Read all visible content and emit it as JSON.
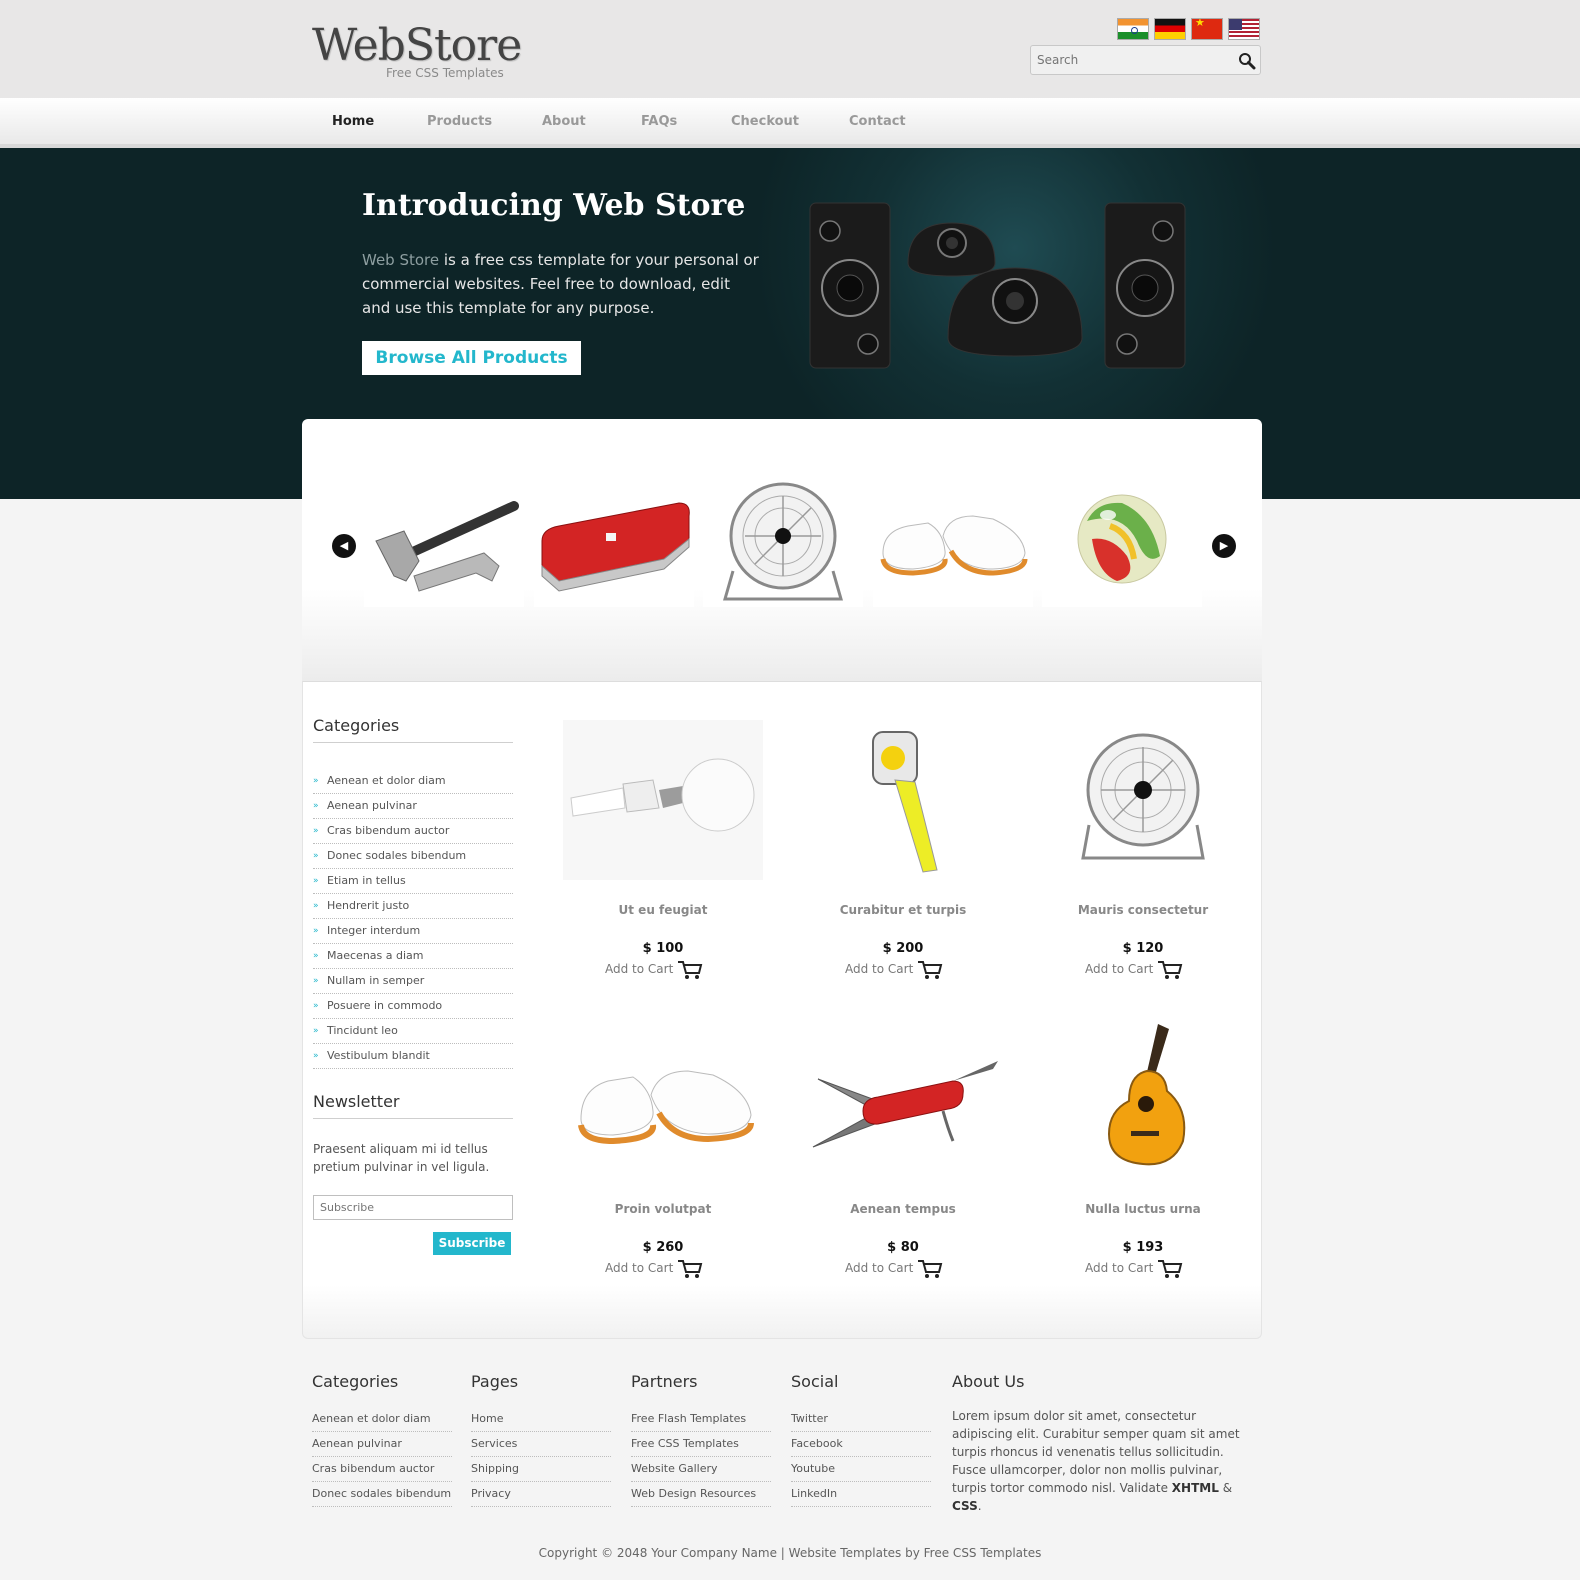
{
  "header": {
    "logo_title": "WebStore",
    "logo_subtitle": "Free CSS Templates",
    "languages": [
      "India",
      "Germany",
      "China",
      "United States"
    ],
    "search_placeholder": "Search"
  },
  "nav": {
    "items": [
      "Home",
      "Products",
      "About",
      "FAQs",
      "Checkout",
      "Contact"
    ],
    "active": "Home"
  },
  "hero": {
    "title": "Introducing Web Store",
    "text_highlight": "Web Store",
    "text_rest": " is a free css template for your personal or commercial websites. Feel free to download, edit and use this template for any purpose.",
    "button_label": "Browse All Products"
  },
  "carousel": {
    "items": [
      "hammer-and-wrench",
      "pocket-knife",
      "desk-fan",
      "white-shoes",
      "glass-marble"
    ]
  },
  "sidebar": {
    "categories_title": "Categories",
    "categories": [
      "Aenean et dolor diam",
      "Aenean pulvinar",
      "Cras bibendum auctor",
      "Donec sodales bibendum",
      "Etiam in tellus",
      "Hendrerit justo",
      "Integer interdum",
      "Maecenas a diam",
      "Nullam in semper",
      "Posuere in commodo",
      "Tincidunt leo",
      "Vestibulum blandit"
    ],
    "newsletter_title": "Newsletter",
    "newsletter_text": "Praesent aliquam mi id tellus pretium pulvinar in vel ligula.",
    "newsletter_placeholder": "Subscribe",
    "newsletter_button": "Subscribe"
  },
  "products": [
    {
      "name": "Ut eu feugiat",
      "price": "$ 100",
      "cart": "Add to Cart",
      "image": "light-bulbs"
    },
    {
      "name": "Curabitur et turpis",
      "price": "$ 200",
      "cart": "Add to Cart",
      "image": "tape-measure"
    },
    {
      "name": "Mauris consectetur",
      "price": "$ 120",
      "cart": "Add to Cart",
      "image": "desk-fan"
    },
    {
      "name": "Proin volutpat",
      "price": "$ 260",
      "cart": "Add to Cart",
      "image": "white-shoes"
    },
    {
      "name": "Aenean tempus",
      "price": "$ 80",
      "cart": "Add to Cart",
      "image": "pocket-knife"
    },
    {
      "name": "Nulla luctus urna",
      "price": "$ 193",
      "cart": "Add to Cart",
      "image": "acoustic-guitar"
    }
  ],
  "footer": {
    "categories": {
      "title": "Categories",
      "links": [
        "Aenean et dolor diam",
        "Aenean pulvinar",
        "Cras bibendum auctor",
        "Donec sodales bibendum"
      ]
    },
    "pages": {
      "title": "Pages",
      "links": [
        "Home",
        "Services",
        "Shipping",
        "Privacy"
      ]
    },
    "partners": {
      "title": "Partners",
      "links": [
        "Free Flash Templates",
        "Free CSS Templates",
        "Website Gallery",
        "Web Design Resources"
      ]
    },
    "social": {
      "title": "Social",
      "links": [
        "Twitter",
        "Facebook",
        "Youtube",
        "LinkedIn"
      ]
    },
    "about": {
      "title": "About Us",
      "text": "Lorem ipsum dolor sit amet, consectetur adipiscing elit. Curabitur semper quam sit amet turpis rhoncus id venenatis tellus sollicitudin. Fusce ullamcorper, dolor non mollis pulvinar, turpis tortor commodo nisl. Validate ",
      "xhtml": "XHTML",
      "amp": " & ",
      "css": "CSS",
      "end": "."
    },
    "copyright": "Copyright © 2048 Your Company Name | Website Templates by Free CSS Templates"
  },
  "colors": {
    "accent": "#23b7cc",
    "hero_bg": "#123034",
    "page_bg": "#f4f4f4",
    "header_bg": "#e8e7e7"
  }
}
